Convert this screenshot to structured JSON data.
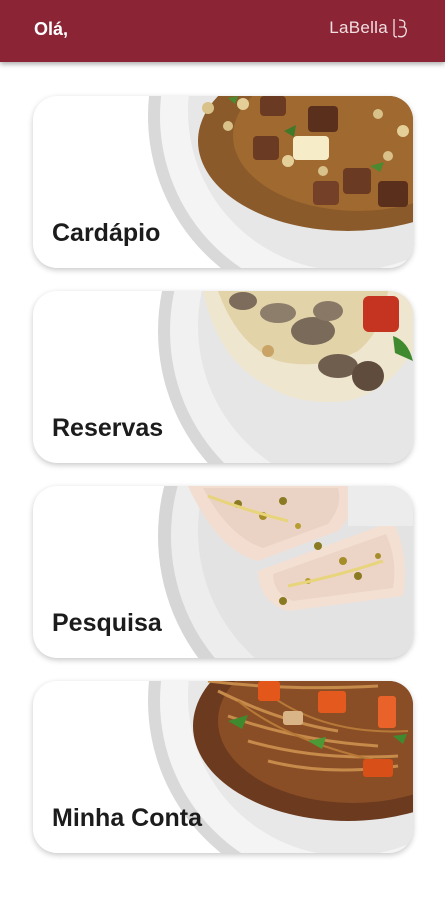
{
  "appbar": {
    "greeting": "Olá,",
    "logo_text": "LaBella",
    "logo_icon": "labella-monogram-icon",
    "background": "#8b2535"
  },
  "menu": [
    {
      "label": "Cardápio",
      "image": "stew-dish-image"
    },
    {
      "label": "Reservas",
      "image": "mushroom-chicken-dish-image"
    },
    {
      "label": "Pesquisa",
      "image": "fish-passionfruit-dish-image"
    },
    {
      "label": "Minha Conta",
      "image": "pasta-vegetables-dish-image"
    }
  ]
}
